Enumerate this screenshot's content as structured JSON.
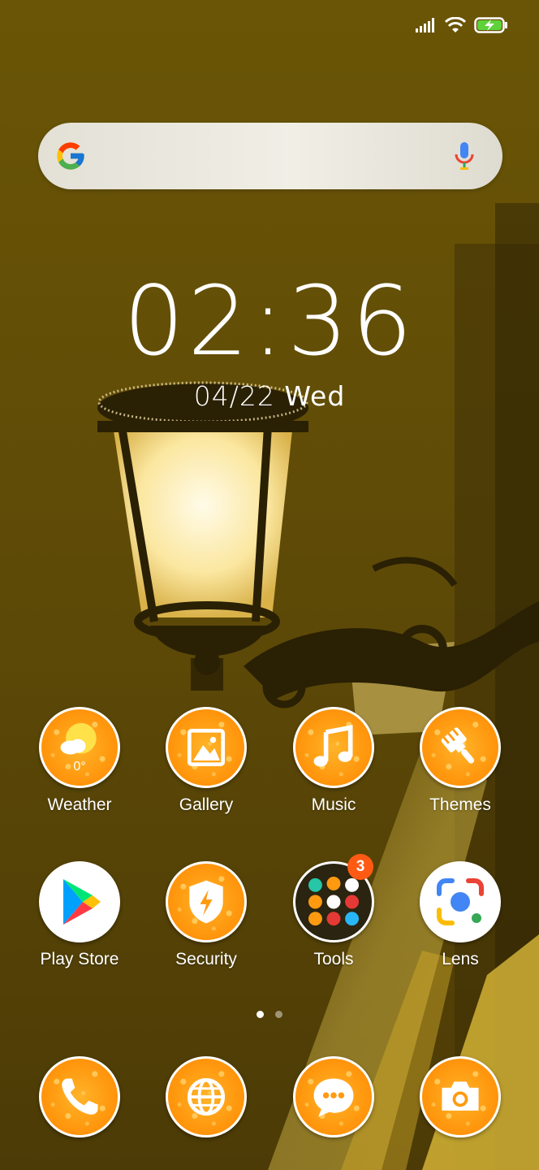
{
  "status_bar": {
    "signal_icon": "signal-bars-icon",
    "wifi_icon": "wifi-icon",
    "battery_icon": "battery-charging-icon",
    "battery_color": "#5fd13a"
  },
  "search": {
    "logo": "google-g-icon",
    "mic": "microphone-icon"
  },
  "clock": {
    "time": "02:36",
    "date_md": "04/22",
    "weekday": "Wed"
  },
  "apps_row1": [
    {
      "label": "Weather",
      "icon": "weather-icon",
      "temp": "0°"
    },
    {
      "label": "Gallery",
      "icon": "gallery-icon"
    },
    {
      "label": "Music",
      "icon": "music-note-icon"
    },
    {
      "label": "Themes",
      "icon": "paintbrush-icon"
    }
  ],
  "apps_row2": [
    {
      "label": "Play Store",
      "icon": "play-store-icon"
    },
    {
      "label": "Security",
      "icon": "security-shield-icon"
    },
    {
      "label": "Tools",
      "icon": "folder-icon",
      "badge": "3"
    },
    {
      "label": "Lens",
      "icon": "lens-icon"
    }
  ],
  "page_indicator": {
    "active_index": 0,
    "count": 2
  },
  "dock": [
    {
      "icon": "phone-icon"
    },
    {
      "icon": "browser-globe-icon"
    },
    {
      "icon": "messages-icon"
    },
    {
      "icon": "camera-icon"
    }
  ],
  "colors": {
    "wallpaper_base": "#6b5708",
    "icon_orange": "#ff9a10",
    "badge": "#ff5a14"
  }
}
